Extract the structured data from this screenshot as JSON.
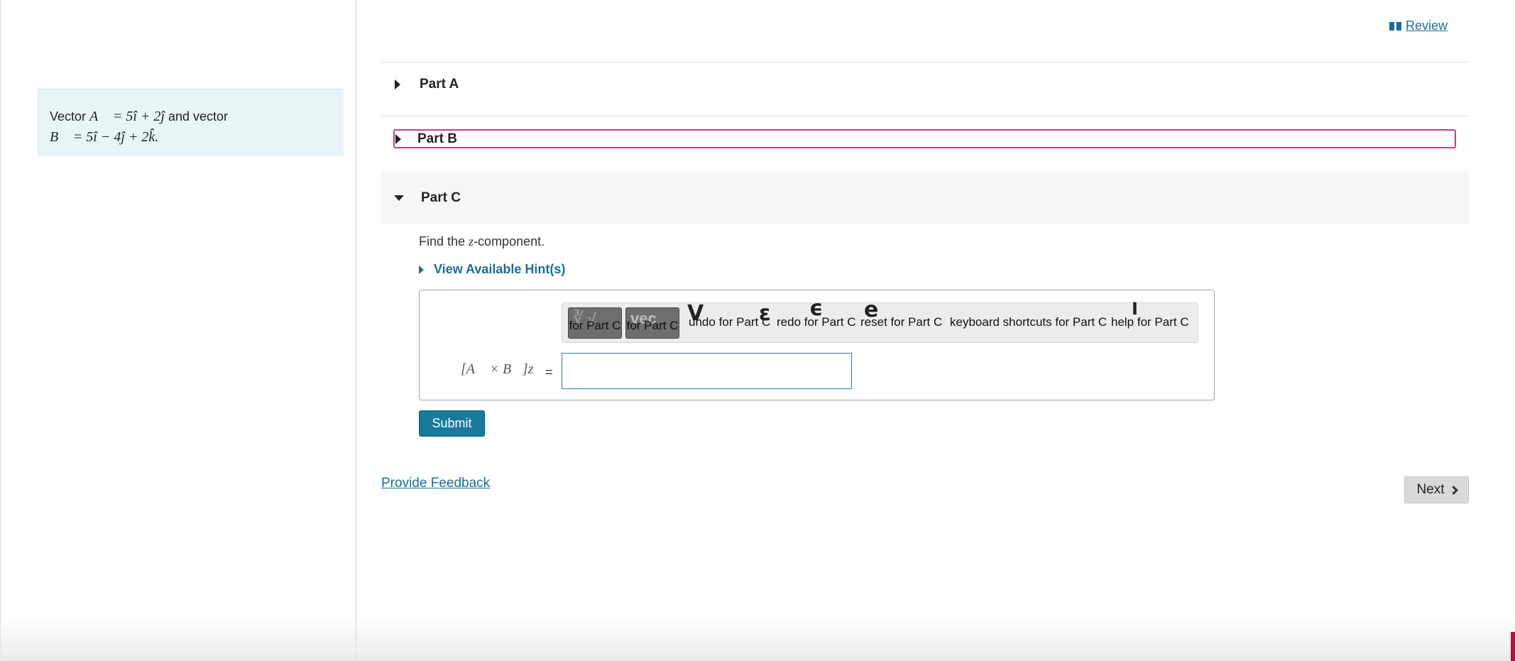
{
  "problem": {
    "text_prefix": "Vector",
    "vec_a": "A⃗ = 5î + 2ĵ",
    "text_mid": "and vector",
    "vec_b": "B⃗ = 5î − 4ĵ + 2k̂."
  },
  "header": {
    "review_label": "Review"
  },
  "parts": {
    "a": "Part A",
    "b": "Part B",
    "c": "Part C"
  },
  "part_c": {
    "prompt_before": "Find the ",
    "prompt_var": "z",
    "prompt_after": "-component.",
    "hint_label": "View Available Hint(s)",
    "toolbar": {
      "templates_ghost": "∛ √",
      "templates_label": "for Part C",
      "vec_ghost": "vec",
      "vec_label": "for Part C",
      "undo_label": "undo for Part C",
      "redo_label": "redo for Part C",
      "reset_label": "reset for Part C",
      "keyboard_label": "keyboard shortcuts for Part C",
      "help_label": "help for Part C"
    },
    "lhs": "[A⃗ × B⃗]z",
    "equals": "=",
    "answer_value": "",
    "submit_label": "Submit"
  },
  "footer": {
    "feedback_label": "Provide Feedback",
    "next_label": "Next"
  },
  "colors": {
    "link": "#1a6e95",
    "submit_bg": "#17799c",
    "focus_outline": "#b0429c",
    "problem_bg": "#e8f5f7"
  }
}
